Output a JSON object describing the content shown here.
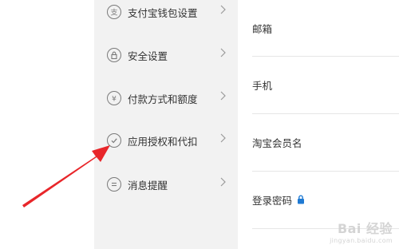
{
  "sidebar": {
    "items": [
      {
        "label": "支付宝钱包设置",
        "icon": "alipay-wallet-icon"
      },
      {
        "label": "安全设置",
        "icon": "lock-icon"
      },
      {
        "label": "付款方式和额度",
        "icon": "yen-icon"
      },
      {
        "label": "应用授权和代扣",
        "icon": "check-icon"
      },
      {
        "label": "消息提醒",
        "icon": "message-icon"
      }
    ]
  },
  "account": {
    "fields": [
      {
        "label": "邮箱"
      },
      {
        "label": "手机"
      },
      {
        "label": "淘宝会员名"
      },
      {
        "label": "登录密码",
        "icon": "lock-icon"
      }
    ]
  },
  "watermark": {
    "text": "Bai 经验",
    "subtext": "jingyan.baidu.com"
  },
  "colors": {
    "sidebar_bg": "#f2f2f2",
    "accent_arrow": "#e8262a",
    "lock_blue": "#1f7ad3"
  }
}
